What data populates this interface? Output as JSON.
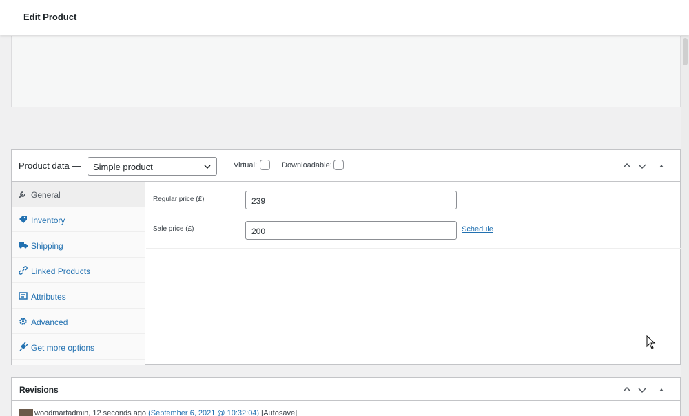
{
  "header": {
    "title": "Edit Product"
  },
  "product_data": {
    "label": "Product data —",
    "product_type": "Simple product",
    "virtual_label": "Virtual:",
    "downloadable_label": "Downloadable:",
    "tabs": [
      {
        "label": "General",
        "icon": "wrench-icon",
        "active": true
      },
      {
        "label": "Inventory",
        "icon": "tag-icon"
      },
      {
        "label": "Shipping",
        "icon": "truck-icon"
      },
      {
        "label": "Linked Products",
        "icon": "link-icon"
      },
      {
        "label": "Attributes",
        "icon": "list-icon"
      },
      {
        "label": "Advanced",
        "icon": "gear-icon"
      },
      {
        "label": "Get more options",
        "icon": "plug-icon"
      }
    ],
    "regular_price_label": "Regular price (£)",
    "regular_price_value": "239",
    "sale_price_label": "Sale price (£)",
    "sale_price_value": "200",
    "schedule_label": "Schedule"
  },
  "revisions": {
    "title": "Revisions",
    "entry": {
      "user": "woodmartadmin",
      "ago": ", 12 seconds ago ",
      "date": "(September 6, 2021 @ 10:32:04)",
      "tag": " [Autosave]"
    }
  },
  "colors": {
    "link": "#2271b1",
    "border": "#c3c4c7",
    "background": "#f0f0f1"
  }
}
